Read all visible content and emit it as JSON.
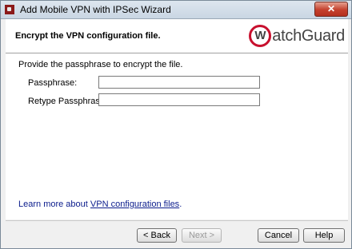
{
  "window": {
    "title": "Add Mobile VPN with IPSec Wizard",
    "close_glyph": "✕"
  },
  "header": {
    "title": "Encrypt the VPN configuration file.",
    "logo_text": "WatchGuard"
  },
  "body": {
    "instruction": "Provide the passphrase to encrypt the file.",
    "passphrase_label": "Passphrase:",
    "passphrase_value": "",
    "retype_label": "Retype Passphrase:",
    "retype_value": "",
    "learn_more_prefix": "Learn more about",
    "learn_more_link": "VPN configuration files",
    "learn_more_suffix": "."
  },
  "buttons": {
    "back": "< Back",
    "next": "Next >",
    "cancel": "Cancel",
    "help": "Help"
  }
}
